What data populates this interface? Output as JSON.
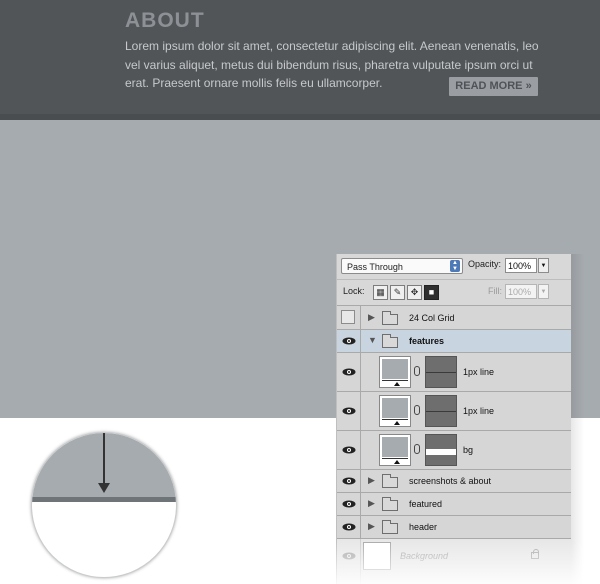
{
  "about": {
    "title": "ABOUT",
    "body": "Lorem ipsum dolor sit amet, consectetur adipiscing elit. Aenean venenatis, leo vel varius aliquet, metus dui bibendum risus, pharetra vulputate ipsum orci ut erat. Praesent ornare mollis felis eu ullamcorper.",
    "read_more": "READ MORE »"
  },
  "colors": {
    "dark_band": "#525558",
    "grey_band": "#a6abaf",
    "line": "#6f7479",
    "selected_row": "#c8d4df"
  },
  "layers_panel": {
    "blend_mode": "Pass Through",
    "opacity_label": "Opacity:",
    "opacity_value": "100%",
    "lock_label": "Lock:",
    "fill_label": "Fill:",
    "fill_value": "100%",
    "layers": [
      {
        "name": "24 Col Grid",
        "kind": "group",
        "visible": false,
        "expanded": false
      },
      {
        "name": "features",
        "kind": "group",
        "visible": true,
        "expanded": true,
        "selected": true
      },
      {
        "name": "1px line",
        "kind": "shape",
        "visible": true
      },
      {
        "name": "1px line",
        "kind": "shape",
        "visible": true
      },
      {
        "name": "bg",
        "kind": "shape",
        "visible": true
      },
      {
        "name": "screenshots & about",
        "kind": "group",
        "visible": true,
        "expanded": false
      },
      {
        "name": "featured",
        "kind": "group",
        "visible": true,
        "expanded": false
      },
      {
        "name": "header",
        "kind": "group",
        "visible": true,
        "expanded": false
      }
    ],
    "background_layer": "Background"
  },
  "icons": {
    "eye": "eye-icon",
    "folder": "folder-icon",
    "chain": "link-chain-icon",
    "lock": "lock-icon",
    "arrow": "arrow-down-icon"
  }
}
